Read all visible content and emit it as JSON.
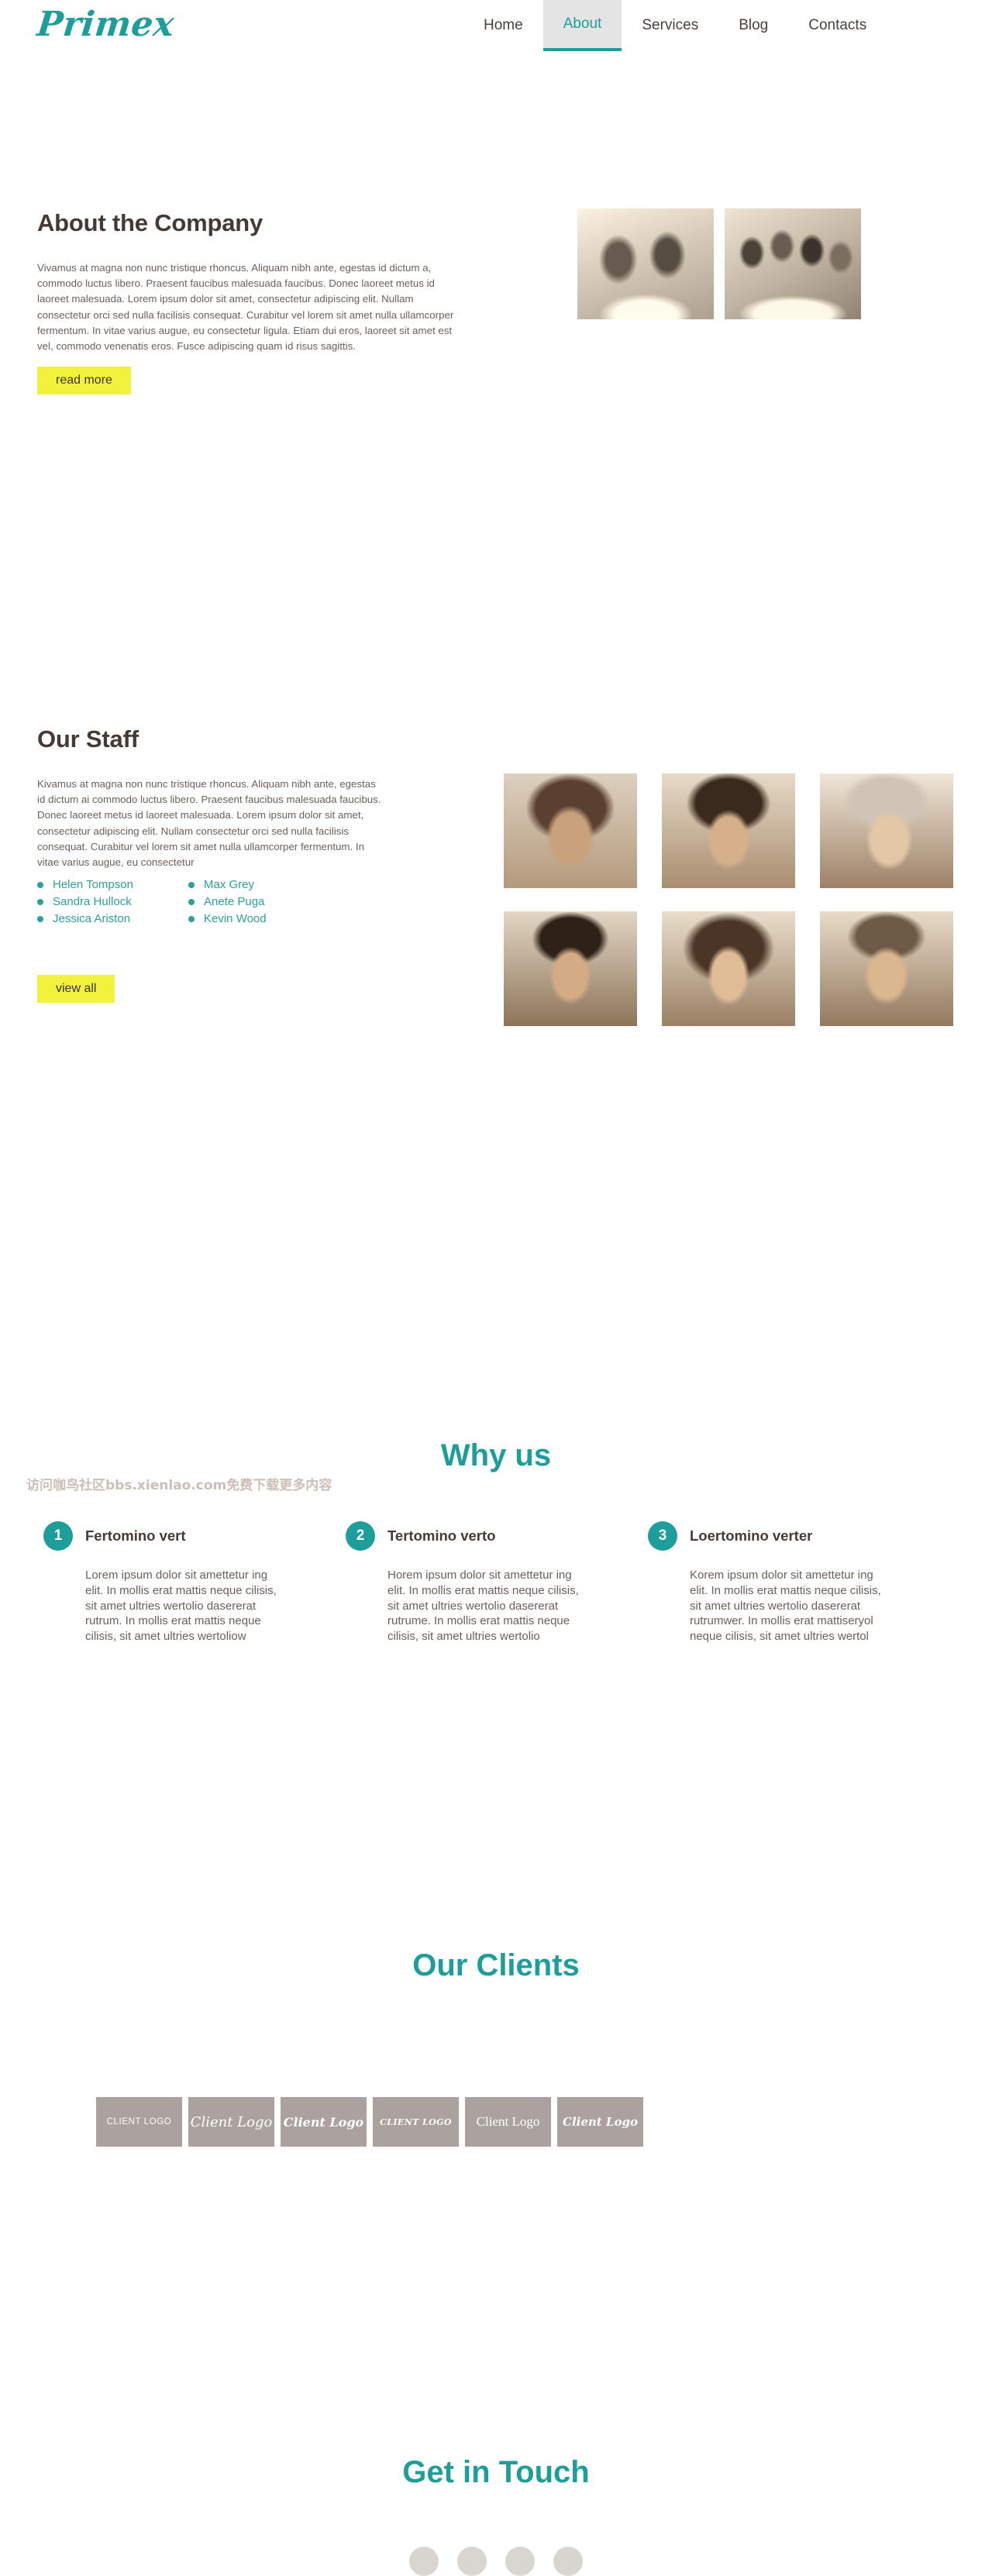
{
  "header": {
    "logo": "Primex",
    "nav": [
      {
        "label": "Home",
        "active": false
      },
      {
        "label": "About",
        "active": true
      },
      {
        "label": "Services",
        "active": false
      },
      {
        "label": "Blog",
        "active": false
      },
      {
        "label": "Contacts",
        "active": false
      }
    ]
  },
  "about": {
    "title": "About the Company",
    "paragraph": "Vivamus at magna non nunc tristique rhoncus. Aliquam nibh ante, egestas id dictum a, commodo luctus libero. Praesent faucibus malesuada faucibus. Donec laoreet metus id laoreet malesuada. Lorem ipsum dolor sit amet, consectetur adipiscing elit. Nullam consectetur orci sed nulla facilisis consequat. Curabitur vel lorem sit amet nulla ullamcorper fermentum. In vitae varius augue, eu consectetur ligula. Etiam dui eros, laoreet sit amet est vel, commodo venenatis eros. Fusce adipiscing quam id risus sagittis.",
    "button": "read more",
    "photos": [
      "team-meeting-photo",
      "office-collaboration-photo"
    ]
  },
  "staff": {
    "title": "Our Staff",
    "paragraph": "Kivamus at magna non nunc tristique rhoncus. Aliquam nibh ante, egestas id dictum ai commodo luctus libero. Praesent faucibus malesuada faucibus. Donec laoreet metus id laoreet malesuada. Lorem ipsum dolor sit amet, consectetur adipiscing elit. Nullam consectetur orci sed nulla facilisis consequat. Curabitur vel lorem sit amet nulla ullamcorper fermentum. In vitae varius augue, eu consectetur",
    "names": [
      "Helen Tompson",
      "Max Grey",
      "Sandra Hullock",
      "Anete Puga",
      "Jessica Ariston",
      "Kevin Wood"
    ],
    "button": "view all",
    "portraits": [
      "portrait-curly-hair-woman",
      "portrait-woman-glasses",
      "portrait-senior-woman",
      "portrait-young-man",
      "portrait-smiling-woman",
      "portrait-man-suit"
    ]
  },
  "why_us": {
    "title": "Why us",
    "cards": [
      {
        "number": "1",
        "title": "Fertomino vert",
        "text": "Lorem ipsum dolor sit amettetur ing elit. In mollis erat mattis neque cilisis, sit amet ultries wertolio dasererat rutrum. In mollis erat mattis neque cilisis, sit amet ultries wertoliow"
      },
      {
        "number": "2",
        "title": "Tertomino verto",
        "text": "Horem ipsum dolor sit amettetur ing elit. In mollis erat mattis neque cilisis, sit amet ultries wertolio dasererat rutrume. In mollis erat mattis neque cilisis, sit amet ultries wertolio"
      },
      {
        "number": "3",
        "title": "Loertomino verter",
        "text": "Korem ipsum dolor sit amettetur ing elit. In mollis erat mattis neque cilisis, sit amet ultries wertolio dasererat rutrumwer. In mollis erat mattiseryol neque cilisis, sit amet ultries wertol"
      }
    ]
  },
  "clients": {
    "title": "Our Clients",
    "logos": [
      "CLIENT LOGO",
      "Client Logo",
      "Client Logo",
      "CLIENT LOGO",
      "Client Logo",
      "Client Logo"
    ]
  },
  "get_in_touch": {
    "title": "Get in Touch",
    "social_icons": [
      "social-icon-1",
      "social-icon-2",
      "social-icon-3",
      "social-icon-4"
    ]
  },
  "watermark": {
    "text": "访问咖鸟社区bbs.xienlao.com免费下载更多内容"
  },
  "colors": {
    "accent_teal": "#1e9e9a",
    "button_yellow": "#f2f23c",
    "heading_brown": "#453a33",
    "body_text": "#6b6059",
    "client_box": "#aba19f"
  }
}
